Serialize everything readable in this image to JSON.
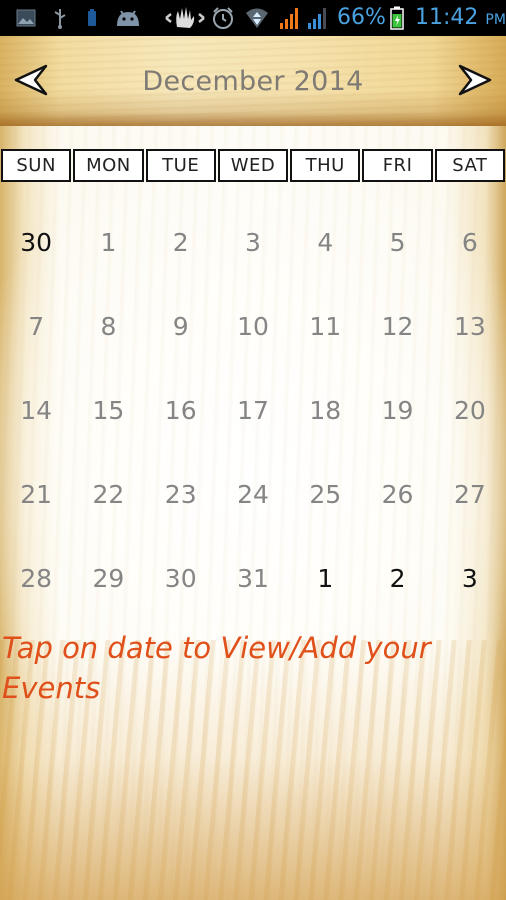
{
  "status_bar": {
    "left_icons": [
      "gallery-icon",
      "usb-icon",
      "battery-small-icon",
      "android-icon",
      "wave-gesture-icon",
      "alarm-icon",
      "wifi-icon"
    ],
    "signal_icons": [
      "signal-orange-icon",
      "signal-blue-icon"
    ],
    "battery_percent": "66%",
    "battery_level": 0.66,
    "time": "11:42",
    "ampm": "PM"
  },
  "header": {
    "month_title": "December 2014",
    "prev_label": "Previous month",
    "next_label": "Next month"
  },
  "weekdays": [
    "SUN",
    "MON",
    "TUE",
    "WED",
    "THU",
    "FRI",
    "SAT"
  ],
  "weeks": [
    [
      {
        "d": "30",
        "other": true
      },
      {
        "d": "1"
      },
      {
        "d": "2"
      },
      {
        "d": "3"
      },
      {
        "d": "4"
      },
      {
        "d": "5"
      },
      {
        "d": "6"
      }
    ],
    [
      {
        "d": "7"
      },
      {
        "d": "8"
      },
      {
        "d": "9"
      },
      {
        "d": "10"
      },
      {
        "d": "11"
      },
      {
        "d": "12"
      },
      {
        "d": "13"
      }
    ],
    [
      {
        "d": "14"
      },
      {
        "d": "15"
      },
      {
        "d": "16"
      },
      {
        "d": "17"
      },
      {
        "d": "18"
      },
      {
        "d": "19"
      },
      {
        "d": "20"
      }
    ],
    [
      {
        "d": "21"
      },
      {
        "d": "22"
      },
      {
        "d": "23"
      },
      {
        "d": "24"
      },
      {
        "d": "25"
      },
      {
        "d": "26"
      },
      {
        "d": "27"
      }
    ],
    [
      {
        "d": "28"
      },
      {
        "d": "29"
      },
      {
        "d": "30"
      },
      {
        "d": "31"
      },
      {
        "d": "1",
        "other": true
      },
      {
        "d": "2",
        "other": true
      },
      {
        "d": "3",
        "other": true
      }
    ]
  ],
  "hint_text": "Tap on date to View/Add your Events",
  "colors": {
    "status_text": "#4aa3e0",
    "month_title": "#7f7b74",
    "current_month_day": "#858585",
    "other_month_day": "#111111",
    "hint": "#e0501a"
  }
}
